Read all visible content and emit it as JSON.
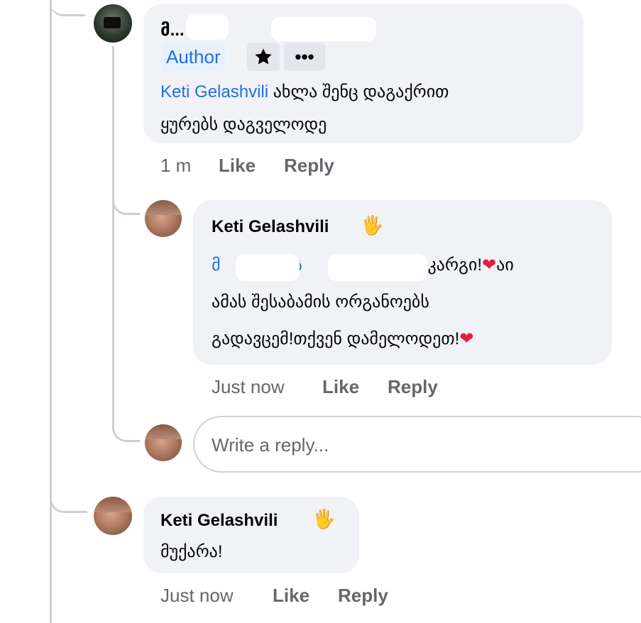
{
  "comment1": {
    "author_name": "მ...   ს...",
    "author_badge": "Author",
    "mention": "Keti Gelashvili",
    "text_line1": "ახლა შენც დაგაქრით",
    "text_line2": "ყურებს დაგველოდე",
    "time": "1 m",
    "like_label": "Like",
    "reply_label": "Reply"
  },
  "comment2": {
    "author_name": "Keti Gelashvili",
    "mention_start": "მ",
    "mention_end": "ს",
    "text_line1_tail": "კარგი!",
    "text_line1_after_heart": "აი",
    "text_line2": "ამას შესაბამის ორგანოებს",
    "text_line3": "გადავცემ!თქვენ დამელოდეთ!",
    "time": "Just now",
    "like_label": "Like",
    "reply_label": "Reply"
  },
  "reply_input": {
    "placeholder": "Write a reply..."
  },
  "comment3": {
    "author_name": "Keti Gelashvili",
    "text": "მუქარა!",
    "time": "Just now",
    "like_label": "Like",
    "reply_label": "Reply"
  },
  "colors": {
    "link": "#216fdb",
    "bubble": "#f0f2f5",
    "meta": "#65676b",
    "heart": "#e41e3f"
  },
  "icons": [
    "star-icon",
    "more-icon",
    "waving-hand-icon",
    "heart-icon"
  ]
}
